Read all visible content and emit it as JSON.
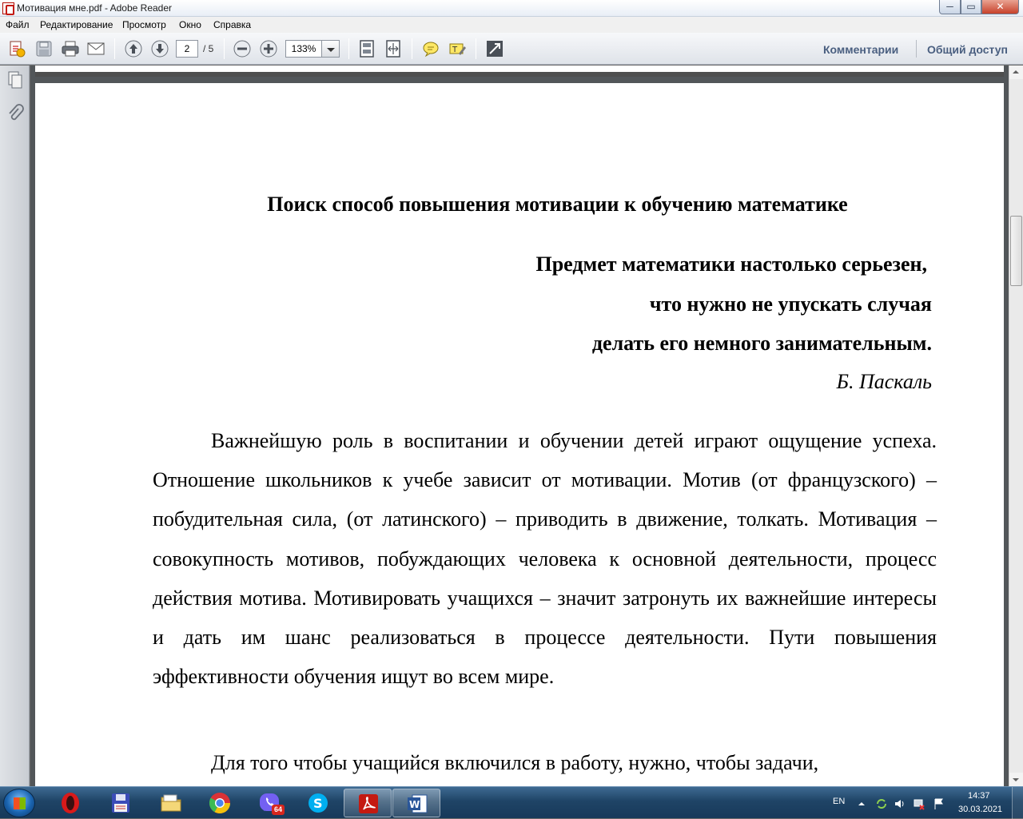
{
  "window": {
    "title": "Мотивация мне.pdf - Adobe Reader",
    "minimize": "─",
    "maximize": "▭",
    "close": "✕"
  },
  "menu": [
    "Файл",
    "Редактирование",
    "Просмотр",
    "Окно",
    "Справка"
  ],
  "toolbar": {
    "current_page": "2",
    "page_total": "/ 5",
    "zoom": "133%",
    "comments_label": "Комментарии",
    "share_label": "Общий доступ"
  },
  "document": {
    "title": "Поиск способ повышения мотивации к обучению математике",
    "epigraph": [
      "Предмет математики настолько серьезен,",
      "что нужно не упускать случая",
      "делать его немного занимательным."
    ],
    "epigraph_author": "Б. Паскаль",
    "paragraphs": [
      "Важнейшую роль в воспитании и обучении детей играют ощущение успеха. Отношение школьников к учебе зависит от мотивации. Мотив (от французского) – побудительная сила, (от латинского) – приводить в движение, толкать. Мотивация – совокупность мотивов, побуждающих человека к основной деятельности, процесс действия мотива. Мотивировать учащихся – значит затронуть их важнейшие интересы и дать им шанс реализоваться в процессе деятельности. Пути повышения эффективности обучения ищут во всем мире.",
      "Для того чтобы учащийся включился в работу, нужно, чтобы задачи,"
    ]
  },
  "taskbar": {
    "viber_badge": "64",
    "language": "EN",
    "time": "14:37",
    "date": "30.03.2021"
  },
  "icons": {
    "app": "pdf-icon",
    "taskbar": [
      "opera-icon",
      "save-disk-icon",
      "folder-icon",
      "chrome-icon",
      "viber-icon",
      "skype-icon",
      "adobe-reader-icon",
      "word-icon"
    ]
  }
}
